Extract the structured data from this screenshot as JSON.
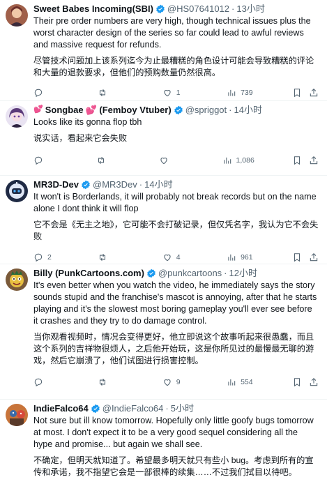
{
  "tweets": [
    {
      "name": "Sweet Babes Incoming(SBI)",
      "handle": "@HS07641012",
      "time": "13小时",
      "text": "Their pre order numbers are very high, though technical issues plus the worst character design of the series so far could lead to awful reviews and massive request for refunds.",
      "translation": "尽管技术问题加上该系列迄今为止最糟糕的角色设计可能会导致糟糕的评论和大量的退款要求，但他们的预购数量仍然很高。",
      "replies": "",
      "retweets": "",
      "likes": "1",
      "views": "739"
    },
    {
      "name_prefix": "💕",
      "name": "Songbae",
      "name_suffix": "💕 (Femboy Vtuber)",
      "handle": "@spriggot",
      "time": "14小时",
      "text": "Looks like its gonna flop tbh",
      "translation": "说实话，看起来它会失败",
      "replies": "",
      "retweets": "",
      "likes": "",
      "views": "1,086"
    },
    {
      "name": "MR3D-Dev",
      "handle": "@MR3Dev",
      "time": "14小时",
      "text": "It won't is Borderlands, it will probably not break records but on the name alone I dont think it will flop",
      "translation": "它不会是《无主之地》，它可能不会打破记录，但仅凭名字，我认为它不会失败",
      "replies": "2",
      "retweets": "",
      "likes": "4",
      "views": "961"
    },
    {
      "name": "Billy (PunkCartoons.com)",
      "handle": "@punkcartoons",
      "time": "12小时",
      "text": "It's even better when you watch the video, he immediately says the story sounds stupid and the franchise's mascot is annoying, after that he starts playing and it's the slowest most boring gameplay you'll ever see before it crashes and they try to do damage control.",
      "translation": "当你观看视频时，情况会变得更好，他立即说这个故事听起来很愚蠢，而且这个系列的吉祥物很烦人，之后他开始玩，这是你所见过的最慢最无聊的游戏，然后它崩溃了，他们试图进行损害控制。",
      "replies": "",
      "retweets": "",
      "likes": "9",
      "views": "554"
    },
    {
      "name": "IndieFalco64",
      "handle": "@IndieFalco64",
      "time": "5小时",
      "text": "Not sure but ill know tomorrow. Hopefully only little goofy bugs tomorrow at most. I don't expect it to be a very good sequel considering all the hype and promise... but again we shall see.",
      "translation": "不确定，但明天就知道了。希望最多明天就只有些小 bug。考虑到所有的宣传和承诺，我不指望它会是一部很棒的续集……不过我们拭目以待吧。",
      "replies": "",
      "retweets": "",
      "likes": "",
      "views": ""
    }
  ],
  "dot": "·",
  "colors": {
    "verified": "#1d9bf0",
    "text": "#0f1419",
    "muted": "#536471",
    "divider": "#eff3f4"
  }
}
